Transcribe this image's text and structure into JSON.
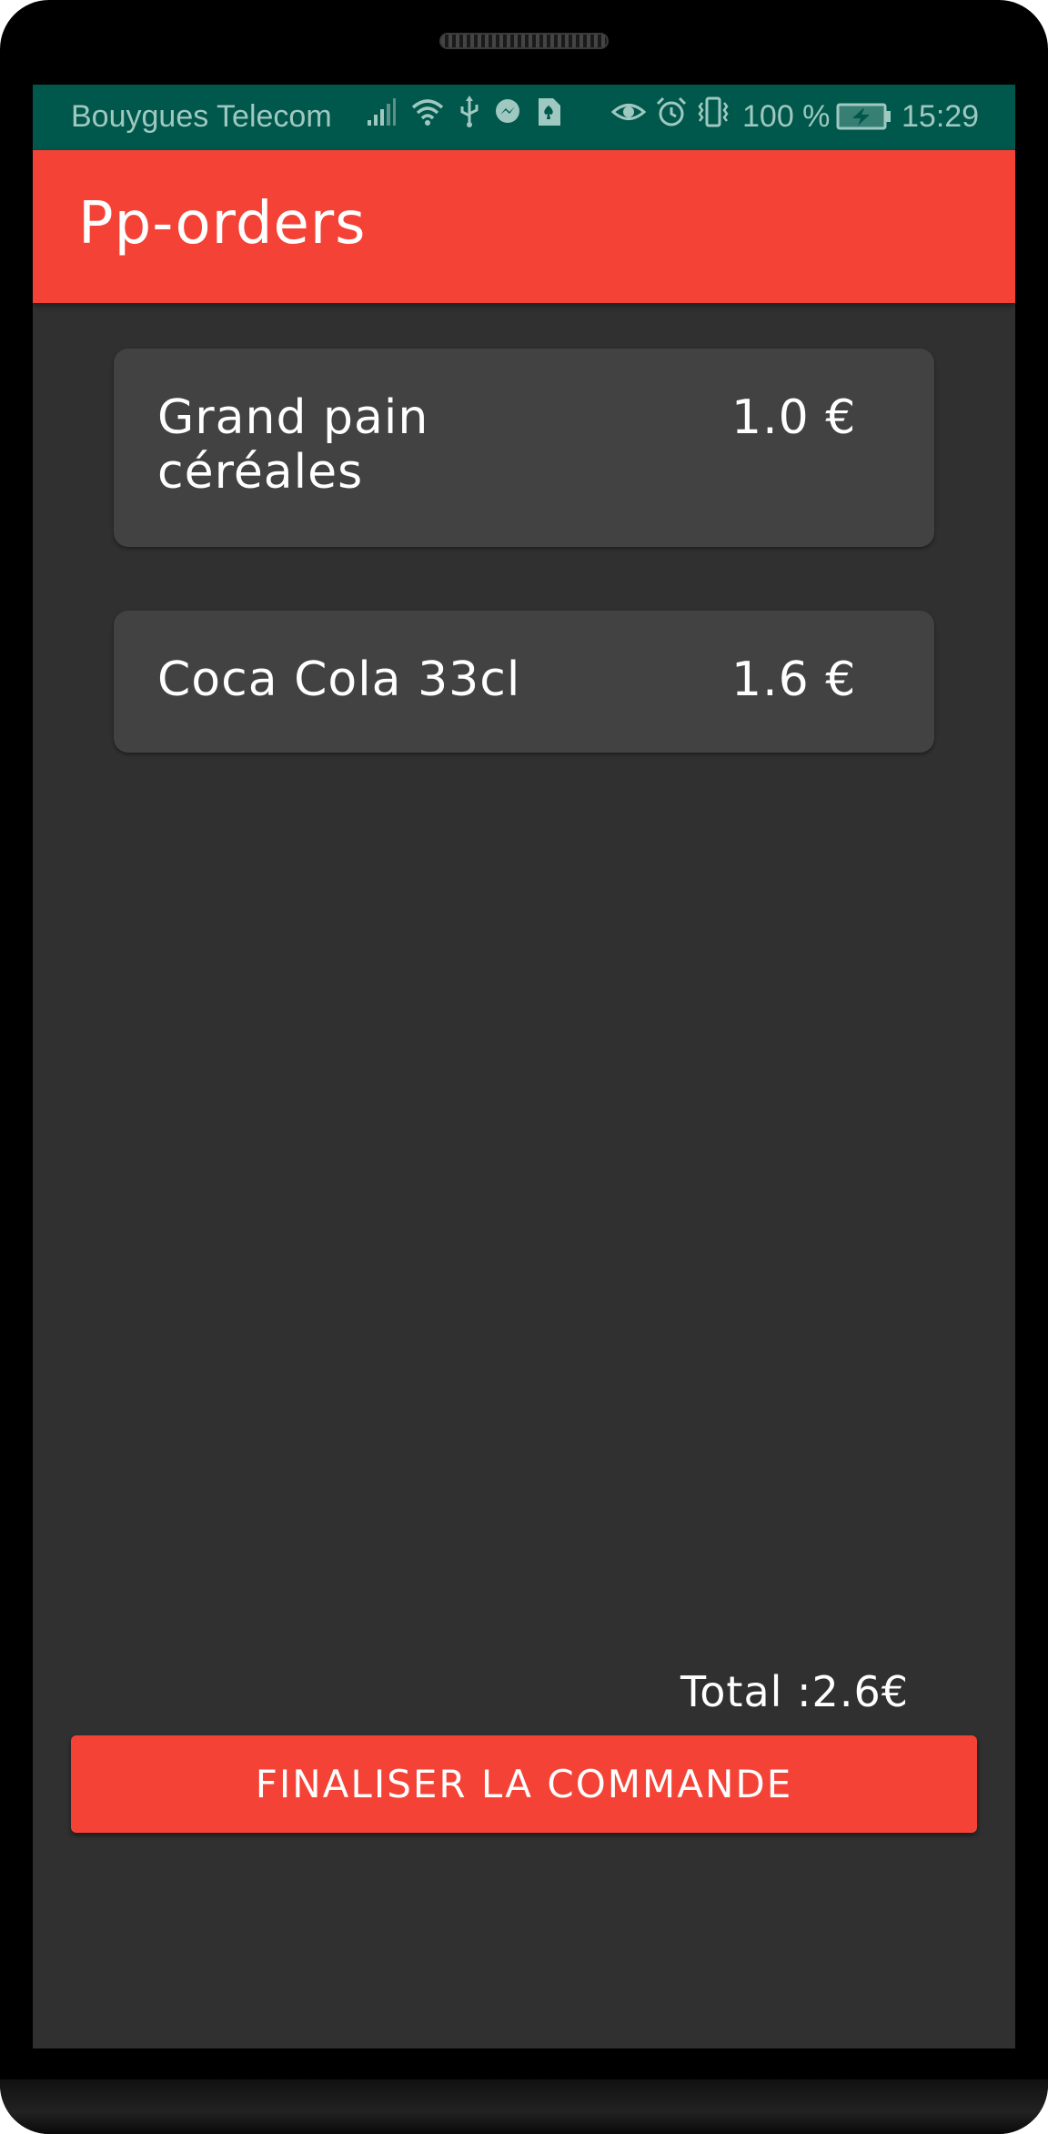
{
  "status_bar": {
    "carrier": "Bouygues Telecom",
    "battery_percent": "100 %",
    "time": "15:29",
    "icons_left": [
      "signal-icon",
      "wifi-icon",
      "usb-icon",
      "messenger-icon",
      "sim-card-icon"
    ],
    "icons_right": [
      "eye-icon",
      "alarm-icon",
      "vibrate-icon",
      "battery-charging-icon"
    ],
    "background": "#00574b"
  },
  "app_bar": {
    "title": "Pp-orders",
    "background": "#f44336"
  },
  "cart": {
    "items": [
      {
        "name": "Grand pain céréales",
        "price": "1.0 €"
      },
      {
        "name": "Coca Cola 33cl",
        "price": "1.6 €"
      }
    ],
    "card_background": "#424242"
  },
  "total_label": "Total :2.6€",
  "checkout_button_label": "FINALISER LA COMMANDE",
  "screen_background": "#303030",
  "accent": "#f44336"
}
